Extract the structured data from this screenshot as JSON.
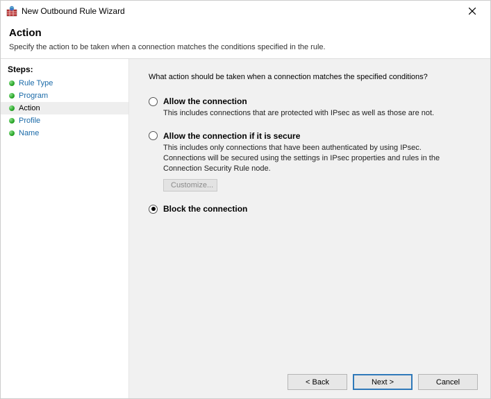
{
  "titlebar": {
    "title": "New Outbound Rule Wizard"
  },
  "header": {
    "heading": "Action",
    "subtitle": "Specify the action to be taken when a connection matches the conditions specified in the rule."
  },
  "sidebar": {
    "heading": "Steps:",
    "items": [
      {
        "label": "Rule Type",
        "active": false
      },
      {
        "label": "Program",
        "active": false
      },
      {
        "label": "Action",
        "active": true
      },
      {
        "label": "Profile",
        "active": false
      },
      {
        "label": "Name",
        "active": false
      }
    ]
  },
  "main": {
    "prompt": "What action should be taken when a connection matches the specified conditions?",
    "options": [
      {
        "id": "allow",
        "title": "Allow the connection",
        "desc": "This includes connections that are protected with IPsec as well as those are not.",
        "selected": false
      },
      {
        "id": "allow-secure",
        "title": "Allow the connection if it is secure",
        "desc": "This includes only connections that have been authenticated by using IPsec.  Connections will be secured using the settings in IPsec properties and rules in the Connection Security Rule node.",
        "selected": false,
        "customize_label": "Customize..."
      },
      {
        "id": "block",
        "title": "Block the connection",
        "desc": "",
        "selected": true
      }
    ]
  },
  "footer": {
    "back": "< Back",
    "next": "Next >",
    "cancel": "Cancel"
  }
}
